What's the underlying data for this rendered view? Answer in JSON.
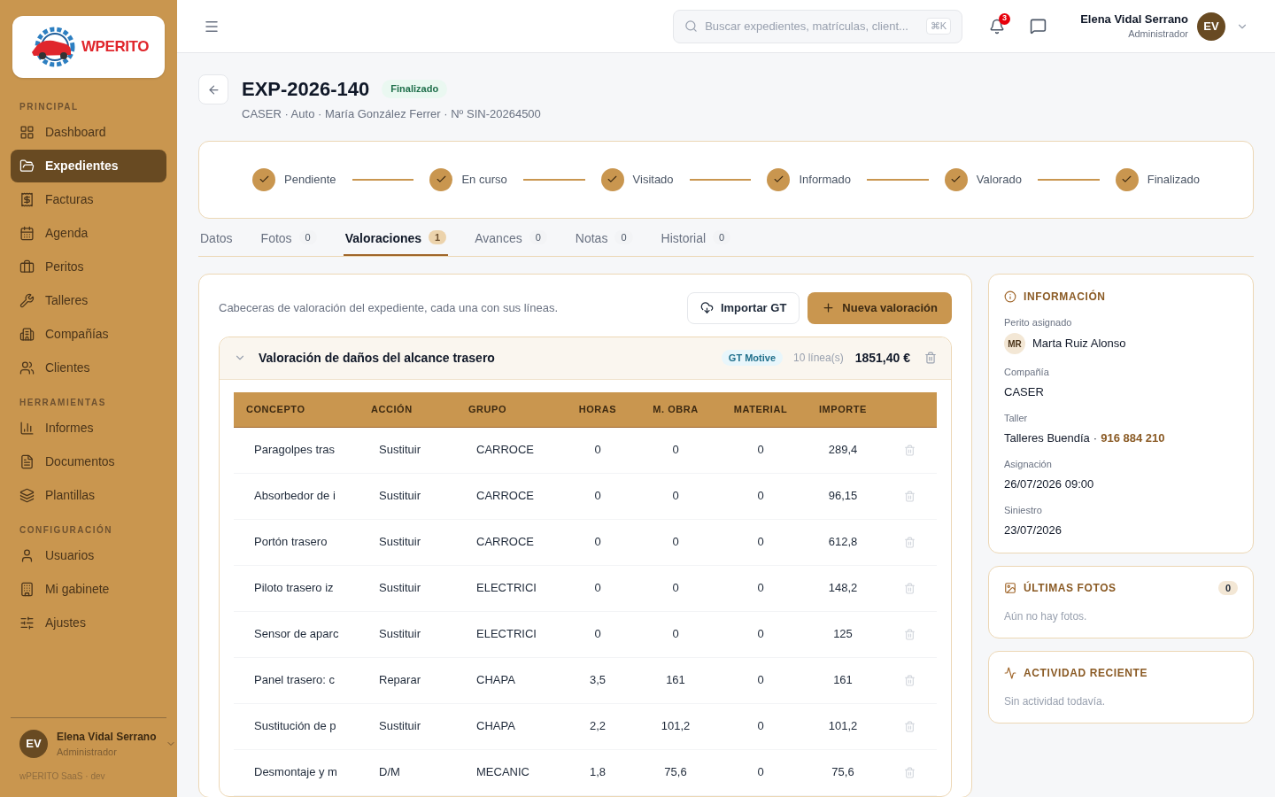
{
  "sidebar": {
    "logo_text": "WPERITO",
    "sections": [
      {
        "title": "PRINCIPAL",
        "items": [
          {
            "label": "Dashboard",
            "selected": false
          },
          {
            "label": "Expedientes",
            "selected": true
          },
          {
            "label": "Facturas",
            "selected": false
          },
          {
            "label": "Agenda",
            "selected": false
          },
          {
            "label": "Peritos",
            "selected": false
          },
          {
            "label": "Talleres",
            "selected": false
          },
          {
            "label": "Compañías",
            "selected": false
          },
          {
            "label": "Clientes",
            "selected": false
          }
        ]
      },
      {
        "title": "HERRAMIENTAS",
        "items": [
          {
            "label": "Informes",
            "selected": false
          },
          {
            "label": "Documentos",
            "selected": false
          },
          {
            "label": "Plantillas",
            "selected": false
          }
        ]
      },
      {
        "title": "CONFIGURACIÓN",
        "items": [
          {
            "label": "Usuarios",
            "selected": false
          },
          {
            "label": "Mi gabinete",
            "selected": false
          },
          {
            "label": "Ajustes",
            "selected": false
          }
        ]
      }
    ],
    "user": {
      "initials": "EV",
      "name": "Elena Vidal Serrano",
      "role": "Administrador"
    },
    "footer": "wPERITO SaaS · dev"
  },
  "topbar": {
    "search": {
      "placeholder": "Buscar expedientes, matrículas, client...",
      "shortcut": "⌘K"
    },
    "notifications": "3",
    "user": {
      "name": "Elena Vidal Serrano",
      "role": "Administrador",
      "initials": "EV"
    }
  },
  "header": {
    "title": "EXP-2026-140",
    "status": "Finalizado",
    "subtitle": "CASER · Auto · María González Ferrer · Nº SIN-20264500"
  },
  "steps": [
    {
      "label": "Pendiente",
      "done": true
    },
    {
      "label": "En curso",
      "done": true
    },
    {
      "label": "Visitado",
      "done": true
    },
    {
      "label": "Informado",
      "done": true
    },
    {
      "label": "Valorado",
      "done": true
    },
    {
      "label": "Finalizado",
      "done": true
    }
  ],
  "tabs": [
    {
      "label": "Datos",
      "selected": false
    },
    {
      "label": "Fotos",
      "count": "0",
      "selected": false
    },
    {
      "label": "Valoraciones",
      "count": "1",
      "selected": true
    },
    {
      "label": "Avances",
      "count": "0",
      "selected": false
    },
    {
      "label": "Notas",
      "count": "0",
      "selected": false
    },
    {
      "label": "Historial",
      "count": "0",
      "selected": false
    }
  ],
  "valoraciones": {
    "description": "Cabeceras de valoración del expediente, cada una con sus líneas.",
    "import_button": "Importar GT",
    "new_button": "Nueva valoración",
    "group": {
      "title": "Valoración de daños del alcance trasero",
      "expanded": true,
      "source": "GT Motive",
      "lines": "10 línea(s)",
      "total": "1851,40 €",
      "table": {
        "columns": [
          "CONCEPTO",
          "ACCIÓN",
          "GRUPO",
          "HORAS",
          "M. OBRA",
          "MATERIAL",
          "IMPORTE"
        ],
        "rows": [
          [
            "Paragolpes tras",
            "Sustituir",
            "CARROCE",
            "0",
            "0",
            "0",
            "289,4"
          ],
          [
            "Absorbedor de i",
            "Sustituir",
            "CARROCE",
            "0",
            "0",
            "0",
            "96,15"
          ],
          [
            "Portón trasero",
            "Sustituir",
            "CARROCE",
            "0",
            "0",
            "0",
            "612,8"
          ],
          [
            "Piloto trasero iz",
            "Sustituir",
            "ELECTRICI",
            "0",
            "0",
            "0",
            "148,2"
          ],
          [
            "Sensor de aparc",
            "Sustituir",
            "ELECTRICI",
            "0",
            "0",
            "0",
            "125"
          ],
          [
            "Panel trasero: c",
            "Reparar",
            "CHAPA",
            "3,5",
            "161",
            "0",
            "161"
          ],
          [
            "Sustitución de p",
            "Sustituir",
            "CHAPA",
            "2,2",
            "101,2",
            "0",
            "101,2"
          ],
          [
            "Desmontaje y m",
            "D/M",
            "MECANIC",
            "1,8",
            "75,6",
            "0",
            "75,6"
          ]
        ]
      }
    }
  },
  "info": {
    "title": "INFORMACIÓN",
    "fields": [
      {
        "label": "Perito asignado",
        "value": "Marta Ruiz Alonso",
        "initials": "MR",
        "kind": "person"
      },
      {
        "label": "Compañía",
        "value": "CASER",
        "kind": "text"
      },
      {
        "label": "Taller",
        "value": "Talleres Buendía",
        "separator": "·",
        "phone": "916 884 210",
        "kind": "contact"
      },
      {
        "label": "Asignación",
        "value": "26/07/2026 09:00",
        "kind": "text"
      },
      {
        "label": "Siniestro",
        "value": "23/07/2026",
        "kind": "text"
      }
    ]
  },
  "photos": {
    "title": "ÚLTIMAS FOTOS",
    "count": "0",
    "empty": "Aún no hay fotos."
  },
  "activity": {
    "title": "ACTIVIDAD RECIENTE",
    "empty": "Sin actividad todavía."
  }
}
